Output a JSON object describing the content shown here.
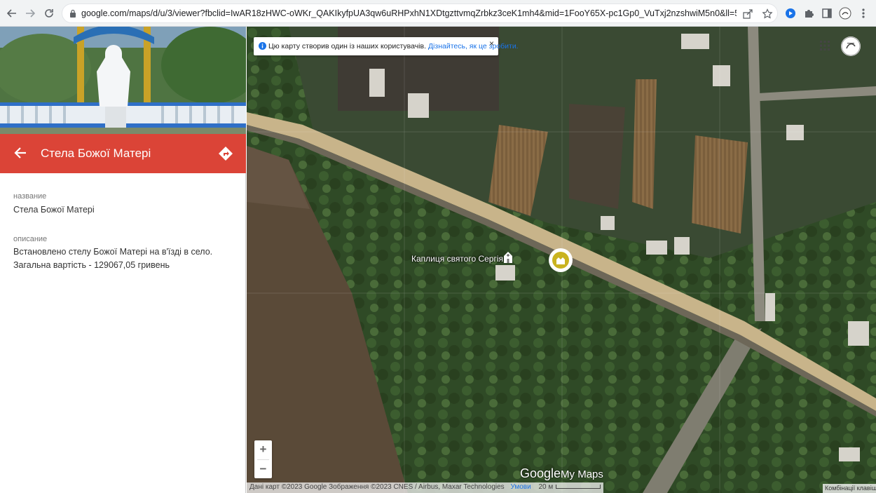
{
  "browser": {
    "url": "google.com/maps/d/u/3/viewer?fbclid=IwAR18zHWC-oWKr_QAKIkyfpUA3qw6uRHPxhN1XDtgzttvmqZrbkz3ceK1mh4&mid=1FooY65X-pc1Gp0_VuTxj2nzshwiM5n0&ll=50.04850750000..."
  },
  "panel": {
    "title": "Стела Божої Матері",
    "fields": [
      {
        "label": "название",
        "value": "Стела Божої Матері"
      },
      {
        "label": "описание",
        "value": "Встановлено стелу Божої Матері на в'їзді в село. Загальна вартість - 129067,05 гривень"
      }
    ]
  },
  "map": {
    "banner": {
      "text": "Цю карту створив один із наших користувачів.",
      "link": "Дізнайтесь, як це зробити.",
      "close": "×"
    },
    "poi_label": "Каплиця святого Сергія",
    "zoom_in": "+",
    "zoom_out": "−",
    "logo_google": "Google",
    "logo_mymaps": "My Maps",
    "attribution": "Дані карт ©2023 Google Зображення ©2023 CNES / Airbus, Maxar Technologies",
    "terms": "Умови",
    "scale_label": "20 м",
    "keyboard": "Комбінації клавіш",
    "colors": {
      "accent": "#db4437",
      "marker": "#c9b320",
      "road": "#c8b48a"
    }
  }
}
